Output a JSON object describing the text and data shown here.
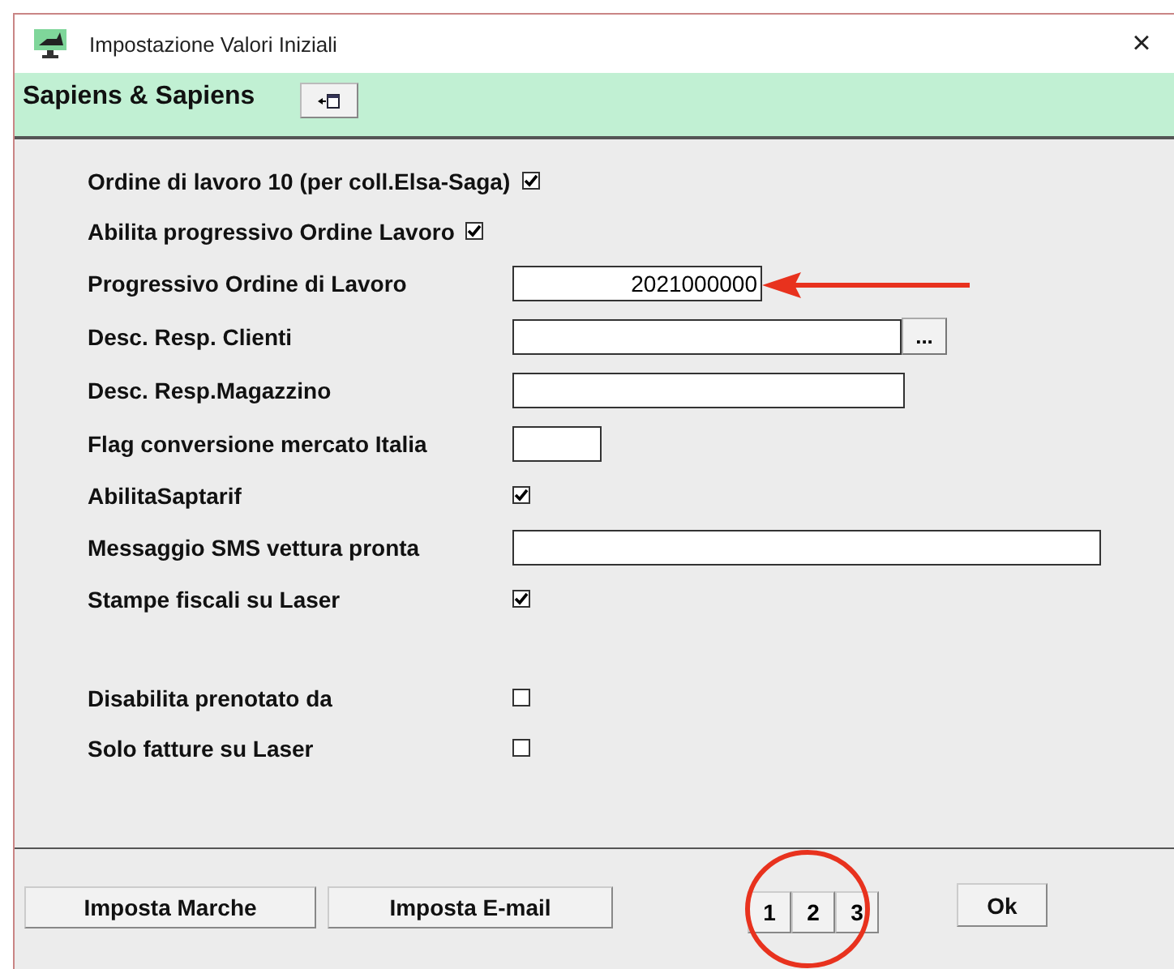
{
  "window": {
    "title": "Impostazione Valori Iniziali",
    "close": "×"
  },
  "header": {
    "title": "Sapiens & Sapiens"
  },
  "rows": [
    {
      "label": "Ordine di lavoro 10 (per coll.Elsa-Saga)",
      "kind": "checkbox",
      "checked": true
    },
    {
      "label": "Abilita progressivo Ordine Lavoro",
      "kind": "checkbox",
      "checked": true
    },
    {
      "label": "Progressivo Ordine di Lavoro",
      "kind": "number_field",
      "value": "2021000000"
    },
    {
      "label": "Desc. Resp. Clienti",
      "kind": "lookup_field",
      "button": "..."
    },
    {
      "label": "Desc. Resp.Magazzino",
      "kind": "text_field"
    },
    {
      "label": "Flag conversione mercato Italia",
      "kind": "short_field"
    },
    {
      "label": "AbilitaSaptarif",
      "kind": "checkbox",
      "checked": true
    },
    {
      "label": "Messaggio SMS vettura pronta",
      "kind": "long_field"
    },
    {
      "label": "Stampe fiscali su Laser",
      "kind": "checkbox",
      "checked": true
    }
  ],
  "extra_rows": [
    {
      "label": "Disabilita prenotato da",
      "kind": "checkbox",
      "checked": false
    },
    {
      "label": "Solo fatture su Laser",
      "kind": "checkbox",
      "checked": false
    }
  ],
  "footer": {
    "buttons": [
      "Imposta Marche",
      "Imposta E-mail"
    ],
    "pages": [
      "1",
      "2",
      "3"
    ],
    "ok": "Ok"
  }
}
